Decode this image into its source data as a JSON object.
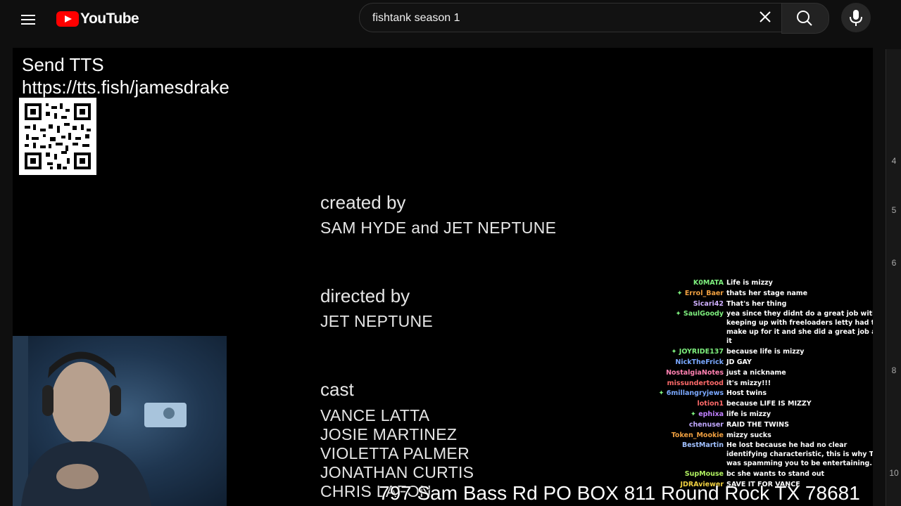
{
  "header": {
    "logo_text": "YouTube",
    "search_value": "fishtank season 1"
  },
  "overlay": {
    "tts_line1": "Send TTS",
    "tts_line2": "https://tts.fish/jamesdrake",
    "address": "797 Sam Bass Rd PO BOX 811 Round Rock TX 78681"
  },
  "credits": [
    {
      "heading": "created by",
      "names": [
        "SAM HYDE and JET NEPTUNE"
      ]
    },
    {
      "heading": "directed by",
      "names": [
        "JET NEPTUNE"
      ]
    },
    {
      "heading": "cast",
      "names": [
        "VANCE LATTA",
        "JOSIE MARTINEZ",
        "VIOLETTA PALMER",
        "JONATHAN CURTIS",
        "CHRIS LAFON"
      ]
    }
  ],
  "chat": [
    {
      "user": "K0MATA",
      "color": "#7ef07e",
      "msg": "Life is mizzy"
    },
    {
      "user": "Errol_Baer",
      "color": "#f0a040",
      "badge": true,
      "msg": "thats her stage name"
    },
    {
      "user": "Sicari42",
      "color": "#d0b0ff",
      "msg": "That's her thing"
    },
    {
      "user": "SaulGoody",
      "color": "#7ef07e",
      "badge": true,
      "msg": "yea since they didnt do a great job with keeping up with freeloaders letty had to make up for it and she did a great job at it"
    },
    {
      "user": "JOYRIDE137",
      "color": "#7ef07e",
      "badge": true,
      "msg": "because life is mizzy"
    },
    {
      "user": "NickTheFrick",
      "color": "#7aa8ff",
      "msg": "JD GAY"
    },
    {
      "user": "NostalgiaNotes",
      "color": "#ff80b0",
      "msg": "just a nickname"
    },
    {
      "user": "missundertood",
      "color": "#ff6a6a",
      "msg": "it's mizzy!!!"
    },
    {
      "user": "6millangryjews",
      "color": "#7aa8ff",
      "badge": true,
      "msg": "Host twins"
    },
    {
      "user": "lotion1",
      "color": "#ff6a6a",
      "msg": "because LIFE IS MIZZY"
    },
    {
      "user": "ephixa",
      "color": "#c080ff",
      "badge": true,
      "msg": "life is mizzy"
    },
    {
      "user": "chenuser",
      "color": "#c0a8ff",
      "msg": "RAID THE TWINS"
    },
    {
      "user": "Token_Mookie",
      "color": "#f0a040",
      "msg": "mizzy sucks"
    },
    {
      "user": "BestMartin",
      "color": "#a0c0ff",
      "msg": "He lost because he had no clear identifying characteristic, this is why TTS was spamming you to be entertaining."
    },
    {
      "user": "SupMouse",
      "color": "#b0f060",
      "msg": "bc she wants to stand out"
    },
    {
      "user": "JDRAviewer",
      "color": "#f0d040",
      "msg": "SAVE IT FOR VANCE"
    }
  ],
  "side_numbers": [
    "4",
    "5",
    "6",
    "8",
    "10"
  ]
}
